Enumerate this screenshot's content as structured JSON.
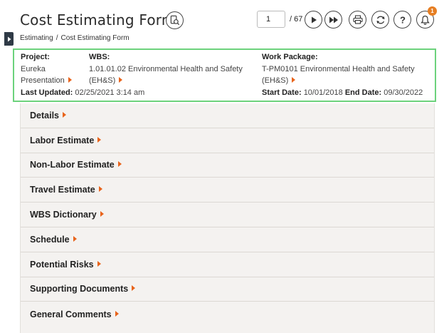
{
  "header": {
    "title": "Cost Estimating Form",
    "page_current": "1",
    "page_total": "/ 67",
    "notification_count": "1"
  },
  "breadcrumb": {
    "items": [
      "Estimating",
      "Cost Estimating Form"
    ],
    "separator": "/"
  },
  "info": {
    "project_label": "Project:",
    "project_value_line1": "Eureka",
    "project_value_line2": "Presentation",
    "wbs_label": "WBS:",
    "wbs_value_line1": "1.01.01.02 Environmental Health and Safety",
    "wbs_value_line2": "(EH&S)",
    "work_package_label": "Work Package:",
    "work_package_line1": "T-PM0101 Environmental Health and Safety",
    "work_package_line2": "(EH&S)",
    "last_updated_label": "Last Updated:",
    "last_updated_value": "02/25/2021 3:14 am",
    "start_date_label": "Start Date:",
    "start_date_value": "10/01/2018",
    "end_date_label": "End Date:",
    "end_date_value": "09/30/2022"
  },
  "sections": [
    "Details",
    "Labor Estimate",
    "Non-Labor Estimate",
    "Travel Estimate",
    "WBS Dictionary",
    "Schedule",
    "Potential Risks",
    "Supporting Documents",
    "General Comments"
  ],
  "colors": {
    "accent_caret": "#e8641c",
    "info_border": "#6cd27c",
    "badge": "#e67e22",
    "section_bg": "#f4f2f0"
  },
  "icons": {
    "title_action": "search-document-icon",
    "next": "play-next-icon",
    "last": "fast-forward-icon",
    "print": "printer-icon",
    "refresh": "refresh-icon",
    "help": "question-icon",
    "notifications": "bell-icon",
    "sidebar": "chevron-right-icon"
  }
}
